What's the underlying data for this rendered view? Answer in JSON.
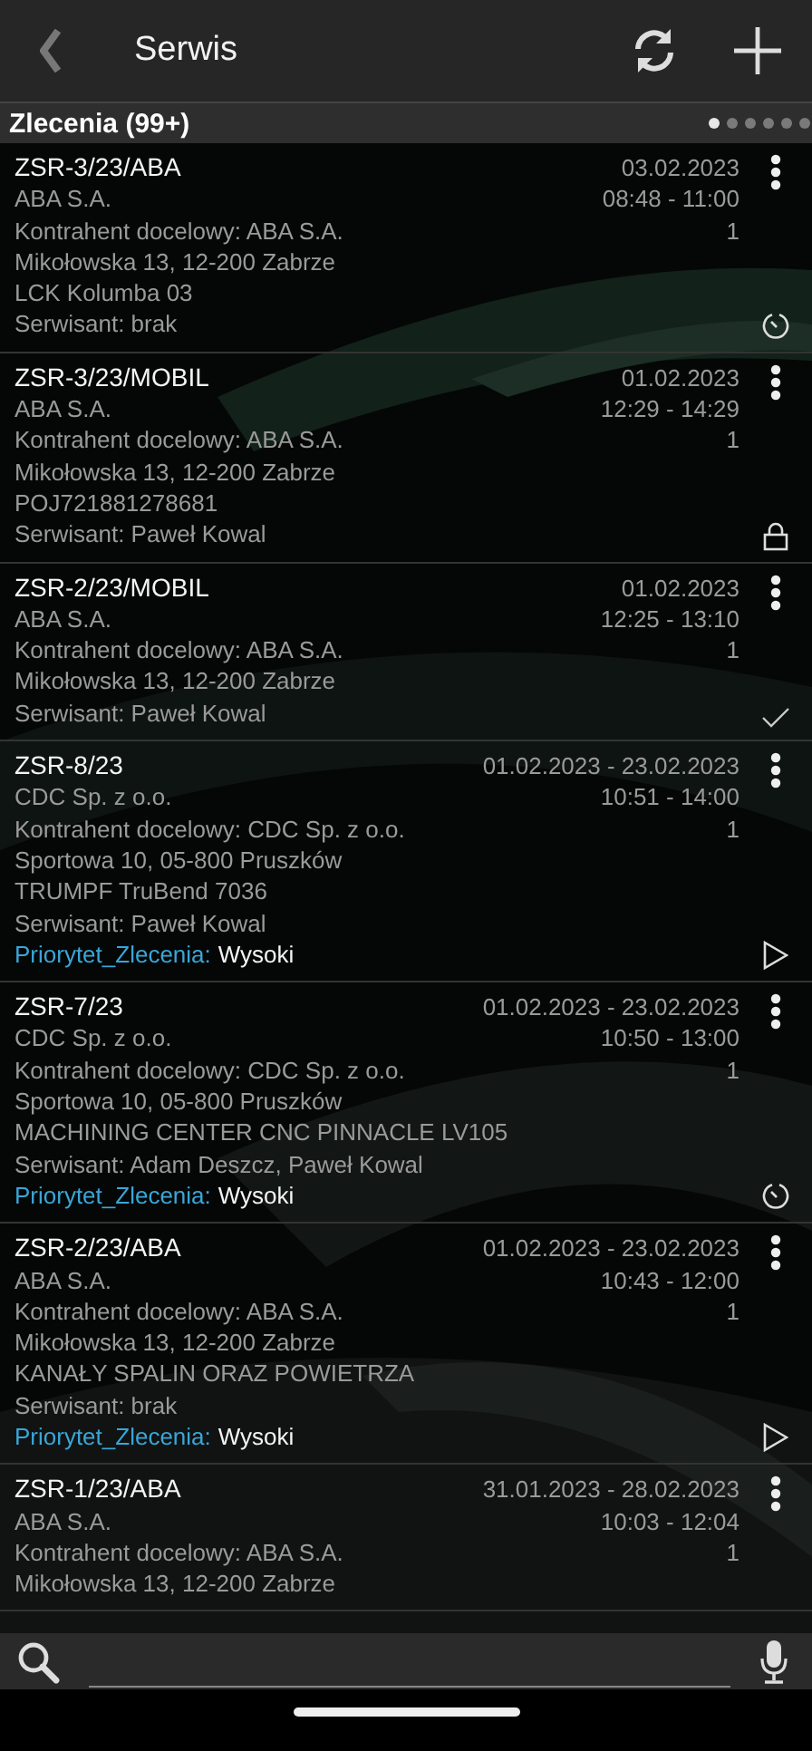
{
  "app_bar": {
    "title": "Serwis"
  },
  "section": {
    "title": "Zlecenia (99+)",
    "pages": [
      {
        "selected": true
      },
      {
        "selected": false
      },
      {
        "selected": false
      },
      {
        "selected": false
      },
      {
        "selected": false
      },
      {
        "selected": false
      }
    ]
  },
  "orders": [
    {
      "number": "ZSR-3/23/ABA",
      "client": "ABA S.A.",
      "details": [
        "Kontrahent docelowy: ABA S.A.",
        "Mikołowska 13, 12-200 Zabrze",
        "LCK Kolumba 03",
        "Serwisant: brak"
      ],
      "date": "03.02.2023",
      "time": "08:48 - 11:00",
      "count": "1",
      "status_icon": {
        "kind": "clock"
      }
    },
    {
      "number": "ZSR-3/23/MOBIL",
      "client": "ABA S.A.",
      "details": [
        "Kontrahent docelowy: ABA S.A.",
        "Mikołowska 13, 12-200 Zabrze",
        "POJ721881278681",
        "Serwisant: Paweł Kowal"
      ],
      "date": "01.02.2023",
      "time": "12:29 - 14:29",
      "count": "1",
      "status_icon": {
        "kind": "lock"
      }
    },
    {
      "number": "ZSR-2/23/MOBIL",
      "client": "ABA S.A.",
      "details": [
        "Kontrahent docelowy: ABA S.A.",
        "Mikołowska 13, 12-200 Zabrze",
        "Serwisant: Paweł Kowal"
      ],
      "date": "01.02.2023",
      "time": "12:25 - 13:10",
      "count": "1",
      "status_icon": {
        "kind": "check"
      }
    },
    {
      "number": "ZSR-8/23",
      "client": "CDC Sp. z o.o.",
      "details": [
        "Kontrahent docelowy: CDC Sp. z o.o.",
        "Sportowa 10, 05-800 Pruszków",
        "TRUMPF TruBend 7036",
        "Serwisant: Paweł Kowal"
      ],
      "priority": {
        "label": "Priorytet_Zlecenia:",
        "value": "Wysoki"
      },
      "date": "01.02.2023 - 23.02.2023",
      "time": "10:51 - 14:00",
      "count": "1",
      "status_icon": {
        "kind": "play"
      }
    },
    {
      "number": "ZSR-7/23",
      "client": "CDC Sp. z o.o.",
      "details": [
        "Kontrahent docelowy: CDC Sp. z o.o.",
        "Sportowa 10, 05-800 Pruszków",
        "MACHINING CENTER CNC PINNACLE LV105",
        "Serwisant: Adam Deszcz, Paweł Kowal"
      ],
      "priority": {
        "label": "Priorytet_Zlecenia:",
        "value": "Wysoki"
      },
      "date": "01.02.2023 - 23.02.2023",
      "time": "10:50 - 13:00",
      "count": "1",
      "status_icon": {
        "kind": "clock"
      }
    },
    {
      "number": "ZSR-2/23/ABA",
      "client": "ABA S.A.",
      "details": [
        "Kontrahent docelowy: ABA S.A.",
        "Mikołowska 13, 12-200 Zabrze",
        "KANAŁY SPALIN ORAZ POWIETRZA",
        "Serwisant: brak"
      ],
      "priority": {
        "label": "Priorytet_Zlecenia:",
        "value": "Wysoki"
      },
      "date": "01.02.2023 - 23.02.2023",
      "time": "10:43 - 12:00",
      "count": "1",
      "status_icon": {
        "kind": "play"
      }
    },
    {
      "number": "ZSR-1/23/ABA",
      "client": "ABA S.A.",
      "details": [
        "Kontrahent docelowy: ABA S.A.",
        "Mikołowska 13, 12-200 Zabrze"
      ],
      "date": "31.01.2023 - 28.02.2023",
      "time": "10:03 - 12:04",
      "count": "1"
    }
  ]
}
